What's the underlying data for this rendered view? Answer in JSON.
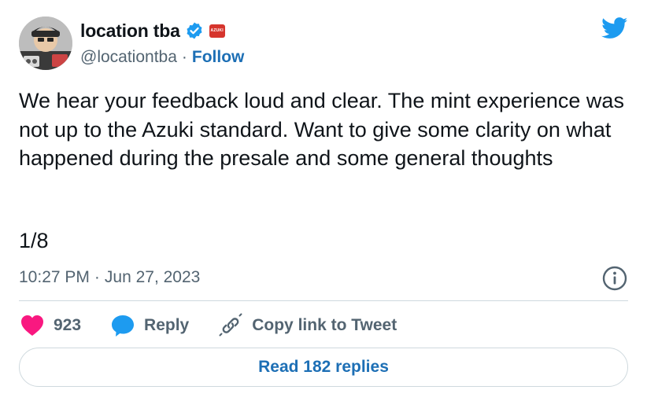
{
  "author": {
    "display_name": "location tba",
    "handle": "@locationtba",
    "separator": "·",
    "follow_label": "Follow",
    "verified_icon": "verified-badge-icon",
    "affiliate_badge_icon": "affiliate-badge-icon",
    "affiliate_badge_text": "AZUKI"
  },
  "tweet": {
    "text": "We hear your feedback loud and clear. The mint experience was not up to the Azuki standard. Want to give some clarity on what happened during the presale and some general thoughts",
    "counter": "1/8",
    "time": "10:27 PM",
    "separator": "·",
    "date": "Jun 27, 2023"
  },
  "actions": {
    "like_count": "923",
    "reply_label": "Reply",
    "copy_link_label": "Copy link to Tweet"
  },
  "footer": {
    "read_replies_label": "Read 182 replies"
  },
  "colors": {
    "accent": "#1d9bf0",
    "link": "#1d6fb5",
    "like": "#f91880",
    "secondary_text": "#536471",
    "border": "#cfd9de"
  },
  "icons": {
    "logo": "twitter-bird-icon",
    "info": "info-icon",
    "like": "heart-icon",
    "reply": "speech-bubble-icon",
    "copy_link": "link-icon"
  }
}
